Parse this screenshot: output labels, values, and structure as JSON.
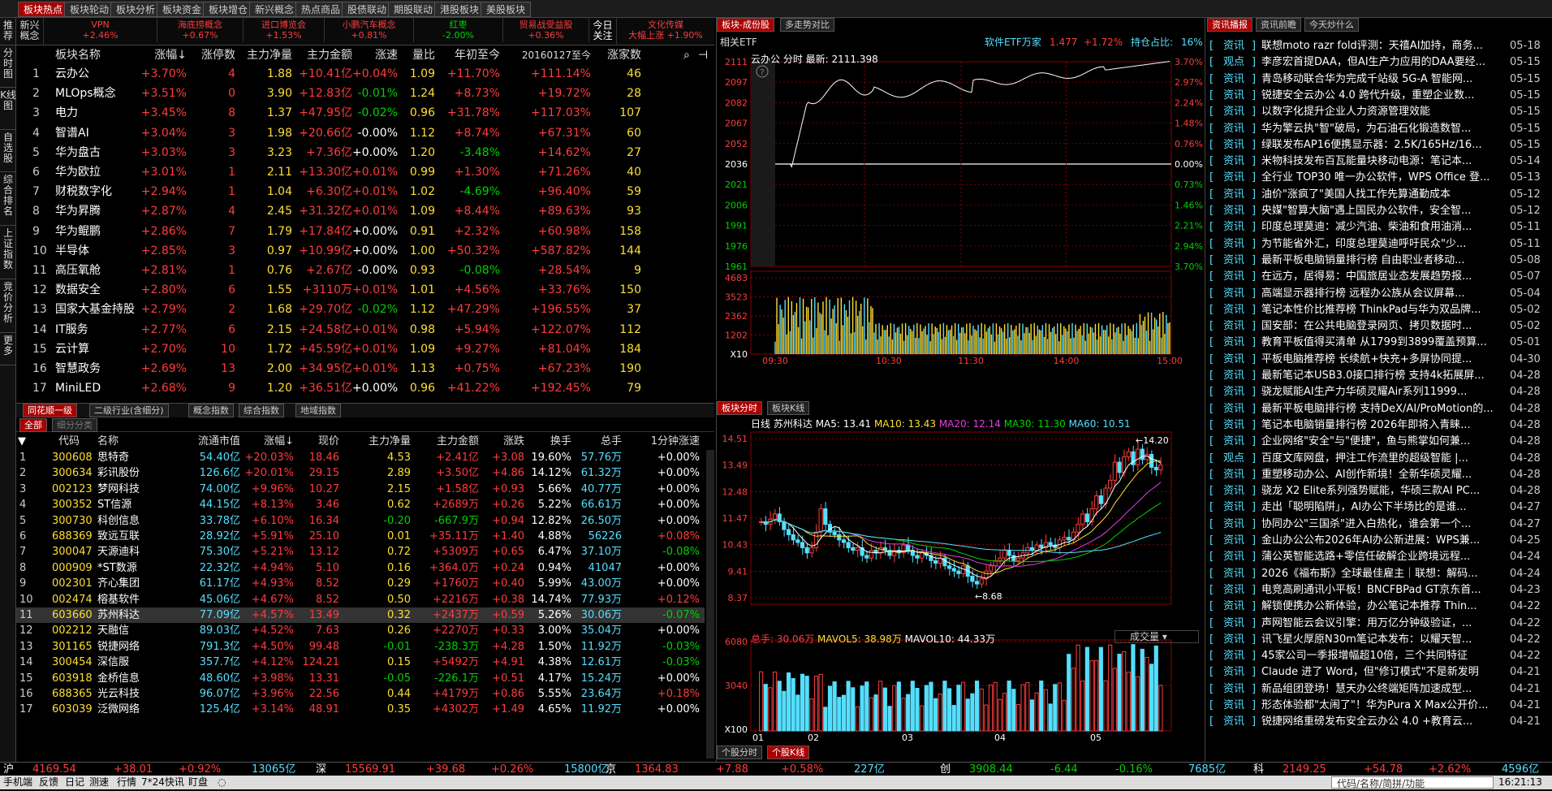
{
  "top_tabs": [
    "板块热点",
    "板块轮动",
    "板块分析",
    "板块资金",
    "板块增仓",
    "新兴概念",
    "热点商品",
    "股债联动",
    "期股联动",
    "港股板块",
    "美股板块"
  ],
  "left_bar": [
    "推荐",
    "分时图",
    "K线图",
    "自选股",
    "综合排名",
    "上证指数",
    "竞价分析",
    "更多"
  ],
  "sectors_bar": {
    "label": "新兴概念",
    "items": [
      {
        "name": "VPN",
        "chg": "+2.46%"
      },
      {
        "name": "海底捞概念",
        "chg": "+0.67%"
      },
      {
        "name": "进口博览会",
        "chg": "+1.53%"
      },
      {
        "name": "小鹏汽车概念",
        "chg": "+0.81%"
      },
      {
        "name": "红枣",
        "chg": "-2.00%"
      },
      {
        "name": "贸易战受益股",
        "chg": "+0.36%"
      }
    ],
    "today_focus": "今日关注",
    "focus_name": "文化传媒",
    "focus_text": "大幅上涨 +1.90%"
  },
  "block_table": {
    "headers": [
      "板块名称",
      "涨幅↓",
      "涨停数",
      "主力净量",
      "主力金额",
      "涨速",
      "量比",
      "年初至今",
      "20160127至今",
      "涨家数"
    ],
    "rows": [
      [
        "1",
        "云办公",
        "+3.70%",
        "4",
        "1.88",
        "+10.41亿",
        "+0.04%",
        "1.09",
        "+11.70%",
        "+111.14%",
        "46"
      ],
      [
        "2",
        "MLOps概念",
        "+3.51%",
        "0",
        "3.90",
        "+12.83亿",
        "-0.01%",
        "1.24",
        "+8.73%",
        "+19.72%",
        "28"
      ],
      [
        "3",
        "电力",
        "+3.45%",
        "8",
        "1.37",
        "+47.95亿",
        "-0.02%",
        "0.96",
        "+31.78%",
        "+117.03%",
        "107"
      ],
      [
        "4",
        "智谱AI",
        "+3.04%",
        "3",
        "1.98",
        "+20.66亿",
        "-0.00%",
        "1.12",
        "+8.74%",
        "+67.31%",
        "60"
      ],
      [
        "5",
        "华为盘古",
        "+3.03%",
        "3",
        "3.23",
        "+7.36亿",
        "+0.00%",
        "1.20",
        "-3.48%",
        "+14.62%",
        "27"
      ],
      [
        "6",
        "华为欧拉",
        "+3.01%",
        "1",
        "2.11",
        "+13.30亿",
        "+0.01%",
        "0.99",
        "+1.30%",
        "+71.26%",
        "40"
      ],
      [
        "7",
        "财税数字化",
        "+2.94%",
        "1",
        "1.04",
        "+6.30亿",
        "+0.01%",
        "1.02",
        "-4.69%",
        "+96.40%",
        "59"
      ],
      [
        "8",
        "华为昇腾",
        "+2.87%",
        "4",
        "2.45",
        "+31.32亿",
        "+0.01%",
        "1.09",
        "+8.44%",
        "+89.63%",
        "93"
      ],
      [
        "9",
        "华为鲲鹏",
        "+2.86%",
        "7",
        "1.79",
        "+17.84亿",
        "+0.00%",
        "0.91",
        "+2.32%",
        "+60.98%",
        "158"
      ],
      [
        "10",
        "半导体",
        "+2.85%",
        "3",
        "0.97",
        "+10.99亿",
        "+0.00%",
        "1.00",
        "+50.32%",
        "+587.82%",
        "144"
      ],
      [
        "11",
        "高压氧舱",
        "+2.81%",
        "1",
        "0.76",
        "+2.67亿",
        "-0.00%",
        "0.93",
        "-0.08%",
        "+28.54%",
        "9"
      ],
      [
        "12",
        "数据安全",
        "+2.80%",
        "6",
        "1.55",
        "+3110万",
        "+0.01%",
        "1.01",
        "+4.56%",
        "+33.76%",
        "150"
      ],
      [
        "13",
        "国家大基金持股",
        "+2.79%",
        "2",
        "1.68",
        "+29.70亿",
        "-0.02%",
        "1.12",
        "+47.29%",
        "+196.55%",
        "37"
      ],
      [
        "14",
        "IT服务",
        "+2.77%",
        "6",
        "2.15",
        "+24.58亿",
        "+0.01%",
        "0.98",
        "+5.94%",
        "+122.07%",
        "112"
      ],
      [
        "15",
        "云计算",
        "+2.70%",
        "10",
        "1.72",
        "+45.59亿",
        "+0.01%",
        "1.09",
        "+9.27%",
        "+81.04%",
        "184"
      ],
      [
        "16",
        "智慧政务",
        "+2.69%",
        "13",
        "2.00",
        "+34.95亿",
        "+0.01%",
        "1.13",
        "+0.75%",
        "+67.23%",
        "190"
      ],
      [
        "17",
        "MiniLED",
        "+2.68%",
        "9",
        "1.20",
        "+36.51亿",
        "+0.00%",
        "0.96",
        "+41.22%",
        "+192.45%",
        "79"
      ]
    ]
  },
  "mid_tabs": [
    "同花顺一级",
    "二级行业(含细分)",
    "概念指数",
    "综合指数",
    "地域指数"
  ],
  "sub_tabs": [
    "全部",
    "细分分类"
  ],
  "stock_table": {
    "headers": [
      "代码",
      "名称",
      "流通市值",
      "涨幅↓",
      "现价",
      "主力净量",
      "主力金额",
      "涨跌",
      "换手",
      "总手",
      "1分钟涨速"
    ],
    "rows": [
      [
        "1",
        "300608",
        "思特奇",
        "54.40亿",
        "+20.03%",
        "18.46",
        "4.53",
        "+2.41亿",
        "+3.08",
        "19.60%",
        "57.76万",
        "+0.00%"
      ],
      [
        "2",
        "300634",
        "彩讯股份",
        "126.6亿",
        "+20.01%",
        "29.15",
        "2.89",
        "+3.50亿",
        "+4.86",
        "14.12%",
        "61.32万",
        "+0.00%"
      ],
      [
        "3",
        "002123",
        "梦网科技",
        "74.00亿",
        "+9.96%",
        "10.27",
        "2.15",
        "+1.58亿",
        "+0.93",
        "5.66%",
        "40.77万",
        "+0.00%"
      ],
      [
        "4",
        "300352",
        "ST信源",
        "44.15亿",
        "+8.13%",
        "3.46",
        "0.62",
        "+2689万",
        "+0.26",
        "5.22%",
        "66.61万",
        "+0.00%"
      ],
      [
        "5",
        "300730",
        "科创信息",
        "33.78亿",
        "+6.10%",
        "16.34",
        "-0.20",
        "-667.9万",
        "+0.94",
        "12.82%",
        "26.50万",
        "+0.00%"
      ],
      [
        "6",
        "688369",
        "致远互联",
        "28.92亿",
        "+5.91%",
        "25.10",
        "0.01",
        "+35.11万",
        "+1.40",
        "4.88%",
        "56226",
        "+0.08%"
      ],
      [
        "7",
        "300047",
        "天源迪科",
        "75.30亿",
        "+5.21%",
        "13.12",
        "0.72",
        "+5309万",
        "+0.65",
        "6.47%",
        "37.10万",
        "-0.08%"
      ],
      [
        "8",
        "000909",
        "*ST数源",
        "22.32亿",
        "+4.94%",
        "5.10",
        "0.16",
        "+364.0万",
        "+0.24",
        "0.94%",
        "41047",
        "+0.00%"
      ],
      [
        "9",
        "002301",
        "齐心集团",
        "61.17亿",
        "+4.93%",
        "8.52",
        "0.29",
        "+1760万",
        "+0.40",
        "5.99%",
        "43.00万",
        "+0.00%"
      ],
      [
        "10",
        "002474",
        "榕基软件",
        "45.06亿",
        "+4.67%",
        "8.52",
        "0.50",
        "+2216万",
        "+0.38",
        "14.74%",
        "77.93万",
        "+0.12%"
      ],
      [
        "11",
        "603660",
        "苏州科达",
        "77.09亿",
        "+4.57%",
        "13.49",
        "0.32",
        "+2437万",
        "+0.59",
        "5.26%",
        "30.06万",
        "-0.07%"
      ],
      [
        "12",
        "002212",
        "天融信",
        "89.03亿",
        "+4.52%",
        "7.63",
        "0.26",
        "+2270万",
        "+0.33",
        "3.00%",
        "35.04万",
        "+0.00%"
      ],
      [
        "13",
        "301165",
        "锐捷网络",
        "791.3亿",
        "+4.50%",
        "99.48",
        "-0.01",
        "-238.3万",
        "+4.28",
        "1.50%",
        "11.92万",
        "-0.03%"
      ],
      [
        "14",
        "300454",
        "深信服",
        "357.7亿",
        "+4.12%",
        "124.21",
        "0.15",
        "+5492万",
        "+4.91",
        "4.38%",
        "12.61万",
        "-0.03%"
      ],
      [
        "15",
        "603918",
        "金桥信息",
        "48.60亿",
        "+3.98%",
        "13.31",
        "-0.05",
        "-226.1万",
        "+0.51",
        "4.17%",
        "15.24万",
        "+0.00%"
      ],
      [
        "16",
        "688365",
        "光云科技",
        "96.07亿",
        "+3.96%",
        "22.56",
        "0.44",
        "+4179万",
        "+0.86",
        "5.55%",
        "23.64万",
        "+0.18%"
      ],
      [
        "17",
        "603039",
        "泛微网络",
        "125.4亿",
        "+3.14%",
        "48.91",
        "0.35",
        "+4302万",
        "+1.49",
        "4.65%",
        "11.92万",
        "+0.00%"
      ]
    ]
  },
  "intraday": {
    "tabs": [
      "板块-成份股",
      "多走势对比"
    ],
    "etf_label": "相关ETF",
    "etf_name": "软件ETF万家",
    "etf_price": "1.477",
    "etf_chg": "+1.72%",
    "holding_label": "持仓占比:",
    "holding_val": "16%",
    "title": "云办公 分时 最新: 2111.398",
    "left_ticks": [
      "2111",
      "2097",
      "2082",
      "2067",
      "2052",
      "2036",
      "2021",
      "2006",
      "1991",
      "1976",
      "1961"
    ],
    "right_ticks": [
      "3.70%",
      "2.97%",
      "2.24%",
      "1.48%",
      "0.76%",
      "0.00%",
      "0.73%",
      "1.46%",
      "2.21%",
      "2.94%",
      "3.70%"
    ],
    "vol_ticks": [
      "4683",
      "3523",
      "2362",
      "1202",
      "X10"
    ],
    "time_ticks": [
      "09:30",
      "10:30",
      "11:30",
      "14:00",
      "15:00"
    ]
  },
  "kline": {
    "tabs": [
      "板块分时",
      "板块K线"
    ],
    "legend": {
      "period": "日线",
      "name": "苏州科达",
      "ma5": "MA5: 13.41",
      "ma10": "MA10: 13.43",
      "ma20": "MA20: 12.14",
      "ma30": "MA30: 11.30",
      "ma60": "MA60: 10.51"
    },
    "price_ticks": [
      "14.51",
      "13.49",
      "12.48",
      "11.47",
      "10.43",
      "9.41",
      "8.37"
    ],
    "high_label": "14.20",
    "low_label": "8.68",
    "vol_legend": {
      "total": "总手: 30.06万",
      "mavol5": "MAVOL5: 38.98万",
      "mavol10": "MAVOL10: 44.33万"
    },
    "vol_dropdown": "成交量",
    "vol_ticks": [
      "6080",
      "3040",
      "X100"
    ],
    "month_ticks": [
      "01",
      "02",
      "03",
      "04",
      "05"
    ],
    "bottom_tabs": [
      "个股分时",
      "个股K线"
    ]
  },
  "news": {
    "tabs": [
      "资讯播报",
      "资讯前瞻",
      "今天炒什么"
    ],
    "items": [
      [
        "资讯",
        "联想moto razr fold评测：天禧AI加持，商务...",
        "05-18"
      ],
      [
        "观点",
        "李彦宏首提DAA，但AI生产力应用的DAA要经...",
        "05-15"
      ],
      [
        "资讯",
        "青岛移动联合华为完成千站级 5G-A 智能网...",
        "05-15"
      ],
      [
        "资讯",
        "锐捷安全云办公 4.0 跨代升级，重塑企业数...",
        "05-15"
      ],
      [
        "资讯",
        "以数字化提升企业人力资源管理效能",
        "05-15"
      ],
      [
        "资讯",
        "华为擎云执\"智\"破局，为石油石化锻造数智...",
        "05-15"
      ],
      [
        "资讯",
        "绿联发布AP16便携显示器：2.5K/165Hz/16...",
        "05-15"
      ],
      [
        "资讯",
        "米物科技发布百瓦能量块移动电源：笔记本...",
        "05-14"
      ],
      [
        "资讯",
        "全行业 TOP30 唯一办公软件，WPS Office 登...",
        "05-13"
      ],
      [
        "资讯",
        "油价\"涨疯了\"美国人找工作先算通勤成本",
        "05-12"
      ],
      [
        "资讯",
        "央媒\"智算大脑\"遇上国民办公软件，安全智...",
        "05-12"
      ],
      [
        "资讯",
        "印度总理莫迪：减少汽油、柴油和食用油消...",
        "05-11"
      ],
      [
        "资讯",
        "为节能省外汇，印度总理莫迪呼吁民众\"少...",
        "05-11"
      ],
      [
        "资讯",
        "最新平板电脑销量排行榜 自由职业者移动...",
        "05-08"
      ],
      [
        "资讯",
        "在远方，居得易：中国旅居业态发展趋势报...",
        "05-07"
      ],
      [
        "资讯",
        "高端显示器排行榜 远程办公族从会议屏幕...",
        "05-04"
      ],
      [
        "资讯",
        "笔记本性价比推荐榜 ThinkPad与华为双品牌...",
        "05-02"
      ],
      [
        "资讯",
        "国安部：在公共电脑登录网页、拷贝数据时...",
        "05-02"
      ],
      [
        "资讯",
        "教育平板值得买清单 从1799到3899覆盖预算...",
        "05-01"
      ],
      [
        "资讯",
        "平板电脑推荐榜 长续航+快充+多屏协同提...",
        "04-30"
      ],
      [
        "资讯",
        "最新笔记本USB3.0接口排行榜 支持4k拓展屏...",
        "04-28"
      ],
      [
        "资讯",
        "骁龙赋能AI生产力华硕灵耀Air系列11999...",
        "04-28"
      ],
      [
        "资讯",
        "最新平板电脑排行榜 支持DeX/AI/ProMotion的...",
        "04-28"
      ],
      [
        "资讯",
        "笔记本电脑销量排行榜 2026年即将入青睐...",
        "04-28"
      ],
      [
        "资讯",
        "企业网络\"安全\"与\"便捷\"，鱼与熊掌如何兼...",
        "04-28"
      ],
      [
        "观点",
        "百度文库网盘，押注工作流里的超级智能 |...",
        "04-28"
      ],
      [
        "资讯",
        "重塑移动办公、AI创作新境！全新华硕灵耀...",
        "04-28"
      ],
      [
        "资讯",
        "骁龙 X2 Elite系列强势赋能，华硕三款AI PC...",
        "04-28"
      ],
      [
        "资讯",
        "走出「聪明陷阱」，AI办公下半场比的是谁...",
        "04-27"
      ],
      [
        "资讯",
        "协同办公\"三国杀\"进入白热化，谁会第一个...",
        "04-27"
      ],
      [
        "资讯",
        "金山办公公布2026年AI办公新进展：WPS兼...",
        "04-25"
      ],
      [
        "资讯",
        "蒲公英智能选路+零信任破解企业跨境远程...",
        "04-24"
      ],
      [
        "资讯",
        "2026《福布斯》全球最佳雇主｜联想：解码...",
        "04-24"
      ],
      [
        "资讯",
        "电竞高刷通讯小平板！BNCFBPad GT京东首...",
        "04-23"
      ],
      [
        "资讯",
        "解锁便携办公新体验，办公笔记本推荐 Thin...",
        "04-22"
      ],
      [
        "资讯",
        "声网智能云会议引擎：用万亿分钟级验证，...",
        "04-22"
      ],
      [
        "资讯",
        "讯飞星火厚原N30m笔记本发布：以耀天智...",
        "04-22"
      ],
      [
        "资讯",
        "45家公司一季报增幅超10倍，三个共同特征",
        "04-22"
      ],
      [
        "资讯",
        "Claude 进了 Word，但\"修订模式\"不是新发明",
        "04-21"
      ],
      [
        "资讯",
        "新品组团登场！慧天办公终端矩阵加速成型...",
        "04-21"
      ],
      [
        "资讯",
        "形态体验都\"太闹了\"！华为Pura X Max公开价...",
        "04-21"
      ],
      [
        "资讯",
        "锐捷网络重磅发布安全云办公 4.0 +教育云...",
        "04-21"
      ]
    ]
  },
  "index_bar": [
    {
      "name": "沪",
      "price": "4169.54",
      "chg": "+38.01",
      "pct": "+0.92%",
      "amt": "13065亿"
    },
    {
      "name": "深",
      "price": "15569.91",
      "chg": "+39.68",
      "pct": "+0.26%",
      "amt": "15800亿"
    },
    {
      "name": "京",
      "price": "1364.83",
      "chg": "+7.88",
      "pct": "+0.58%",
      "amt": "227亿"
    },
    {
      "name": "创",
      "price": "3908.44",
      "chg": "-6.44",
      "pct": "-0.16%",
      "amt": "7685亿"
    },
    {
      "name": "科",
      "price": "2149.25",
      "chg": "+54.78",
      "pct": "+2.62%",
      "amt": "4596亿"
    }
  ],
  "status": {
    "items": [
      "手机端",
      "反馈",
      "日记",
      "测速",
      "行情",
      "7*24快讯",
      "盯盘"
    ],
    "search_placeholder": "代码/名称/简拼/功能",
    "time": "16:21:13"
  }
}
